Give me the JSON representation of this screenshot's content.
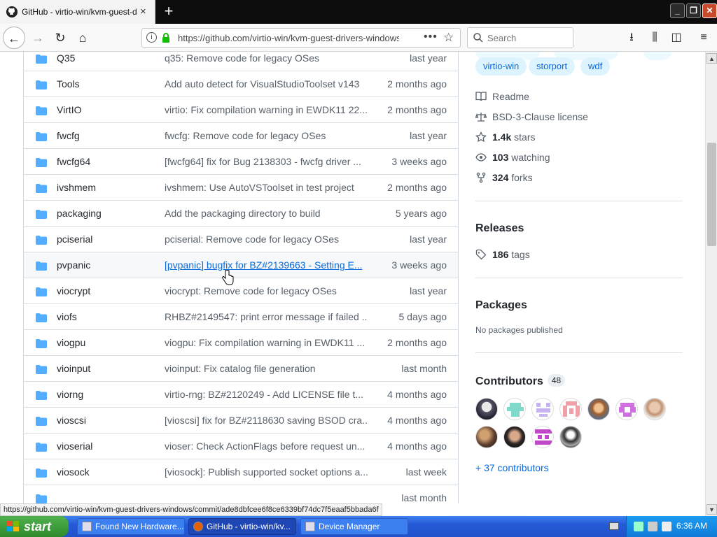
{
  "browser": {
    "tab_title": "GitHub - virtio-win/kvm-guest-drivers-windows",
    "tab_close": "×",
    "new_tab": "+",
    "url": "https://github.com/virtio-win/kvm-guest-drivers-windows",
    "search_placeholder": "Search",
    "status_link": "https://github.com/virtio-win/kvm-guest-drivers-windows/commit/ade8dbfcee6f8ce6339bf74dc7f5eaaf5bbada6f"
  },
  "files": [
    {
      "name": "Q35",
      "message": "q35: Remove code for legacy OSes",
      "age": "last year"
    },
    {
      "name": "Tools",
      "message": "Add auto detect for VisualStudioToolset v143",
      "age": "2 months ago"
    },
    {
      "name": "VirtIO",
      "message": "virtio: Fix compilation warning in EWDK11 22...",
      "age": "2 months ago"
    },
    {
      "name": "fwcfg",
      "message": "fwcfg: Remove code for legacy OSes",
      "age": "last year"
    },
    {
      "name": "fwcfg64",
      "message": "[fwcfg64] fix for Bug 2138303 - fwcfg driver ...",
      "age": "3 weeks ago"
    },
    {
      "name": "ivshmem",
      "message": "ivshmem: Use AutoVSToolset in test project",
      "age": "2 months ago"
    },
    {
      "name": "packaging",
      "message": "Add the packaging directory to build",
      "age": "5 years ago"
    },
    {
      "name": "pciserial",
      "message": "pciserial: Remove code for legacy OSes",
      "age": "last year"
    },
    {
      "name": "pvpanic",
      "message": "[pvpanic] bugfix for BZ#2139663 - Setting E...",
      "age": "3 weeks ago"
    },
    {
      "name": "viocrypt",
      "message": "viocrypt: Remove code for legacy OSes",
      "age": "last year"
    },
    {
      "name": "viofs",
      "message": "RHBZ#2149547: print error message if failed ...",
      "age": "5 days ago"
    },
    {
      "name": "viogpu",
      "message": "viogpu: Fix compilation warning in EWDK11 ...",
      "age": "2 months ago"
    },
    {
      "name": "vioinput",
      "message": "vioinput: Fix catalog file generation",
      "age": "last month"
    },
    {
      "name": "viorng",
      "message": "virtio-rng: BZ#2120249 - Add LICENSE file t...",
      "age": "4 months ago"
    },
    {
      "name": "vioscsi",
      "message": "[vioscsi] fix for BZ#2118630 saving BSOD cra...",
      "age": "4 months ago"
    },
    {
      "name": "vioserial",
      "message": "vioser: Check ActionFlags before request un...",
      "age": "4 months ago"
    },
    {
      "name": "viosock",
      "message": "[viosock]: Publish supported socket options a...",
      "age": "last week"
    },
    {
      "name": "",
      "message": "",
      "age": "last month"
    }
  ],
  "sidebar": {
    "topics": [
      "virtio-win",
      "storport",
      "wdf"
    ],
    "readme": "Readme",
    "license": "BSD-3-Clause license",
    "stars_count": "1.4k",
    "stars_label": "stars",
    "watching_count": "103",
    "watching_label": "watching",
    "forks_count": "324",
    "forks_label": "forks",
    "releases_title": "Releases",
    "tags_count": "186",
    "tags_label": "tags",
    "packages_title": "Packages",
    "packages_empty": "No packages published",
    "contributors_title": "Contributors",
    "contributors_count": "48",
    "more_contributors": "+ 37 contributors"
  },
  "taskbar": {
    "start": "start",
    "tasks": [
      "Found New Hardware...",
      "GitHub - virtio-win/kv...",
      "Device Manager"
    ],
    "clock": "6:36 AM"
  },
  "colors": {
    "accent": "#0969da",
    "folder": "#54aeff",
    "topic_bg": "#ddf4ff"
  }
}
